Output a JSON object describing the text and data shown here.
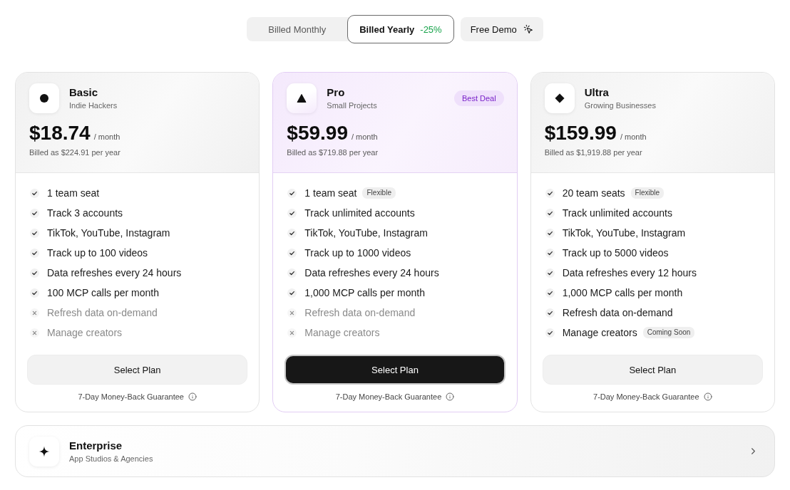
{
  "billing_toggle": {
    "options": [
      {
        "label": "Billed Monthly",
        "selected": false
      },
      {
        "label": "Billed Yearly",
        "discount": "-25%",
        "selected": true
      }
    ]
  },
  "demo_button": {
    "label": "Free Demo"
  },
  "plans": [
    {
      "name": "Basic",
      "audience": "Indie Hackers",
      "featured": false,
      "price": "$18.74",
      "period": "/ month",
      "billing_note": "Billed as $224.91 per year",
      "features": [
        {
          "text": "1 team seat",
          "included": true
        },
        {
          "text": "Track 3 accounts",
          "included": true
        },
        {
          "text": "TikTok, YouTube, Instagram",
          "included": true
        },
        {
          "text": "Track up to 100 videos",
          "included": true
        },
        {
          "text": "Data refreshes every 24 hours",
          "included": true
        },
        {
          "text": "100 MCP calls per month",
          "included": true
        },
        {
          "text": "Refresh data on-demand",
          "included": false
        },
        {
          "text": "Manage creators",
          "included": false
        }
      ],
      "button": "Select Plan",
      "guarantee": "7-Day Money-Back Guarantee"
    },
    {
      "name": "Pro",
      "audience": "Small Projects",
      "featured": true,
      "badge": "Best Deal",
      "price": "$59.99",
      "period": "/ month",
      "billing_note": "Billed as $719.88 per year",
      "features": [
        {
          "text": "1 team seat",
          "included": true,
          "tag": "Flexible"
        },
        {
          "text": "Track unlimited accounts",
          "included": true
        },
        {
          "text": "TikTok, YouTube, Instagram",
          "included": true
        },
        {
          "text": "Track up to 1000 videos",
          "included": true
        },
        {
          "text": "Data refreshes every 24 hours",
          "included": true
        },
        {
          "text": "1,000 MCP calls per month",
          "included": true
        },
        {
          "text": "Refresh data on-demand",
          "included": false
        },
        {
          "text": "Manage creators",
          "included": false
        }
      ],
      "button": "Select Plan",
      "guarantee": "7-Day Money-Back Guarantee"
    },
    {
      "name": "Ultra",
      "audience": "Growing Businesses",
      "featured": false,
      "price": "$159.99",
      "period": "/ month",
      "billing_note": "Billed as $1,919.88 per year",
      "features": [
        {
          "text": "20 team seats",
          "included": true,
          "tag": "Flexible"
        },
        {
          "text": "Track unlimited accounts",
          "included": true
        },
        {
          "text": "TikTok, YouTube, Instagram",
          "included": true
        },
        {
          "text": "Track up to 5000 videos",
          "included": true
        },
        {
          "text": "Data refreshes every 12 hours",
          "included": true
        },
        {
          "text": "1,000 MCP calls per month",
          "included": true
        },
        {
          "text": "Refresh data on-demand",
          "included": true
        },
        {
          "text": "Manage creators",
          "included": true,
          "tag": "Coming Soon"
        }
      ],
      "button": "Select Plan",
      "guarantee": "7-Day Money-Back Guarantee"
    }
  ],
  "enterprise": {
    "name": "Enterprise",
    "audience": "App Studios & Agencies"
  }
}
